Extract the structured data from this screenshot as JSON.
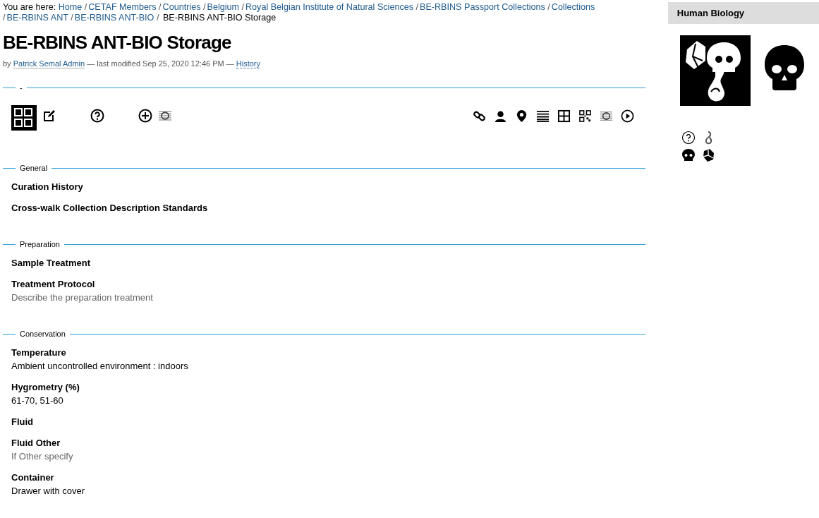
{
  "breadcrumb": {
    "prefix": "You are here:",
    "separator": "/",
    "links": [
      "Home",
      "CETAF Members",
      "Countries",
      "Belgium",
      "Royal Belgian Institute of Natural Sciences",
      "BE-RBINS Passport Collections",
      "Collections",
      "BE-RBINS ANT",
      "BE-RBINS ANT-BIO"
    ],
    "current": "BE-RBINS ANT-BIO Storage"
  },
  "title": "BE-RBINS ANT-BIO Storage",
  "byline": {
    "by": "by",
    "author": "Patrick Semal Admin",
    "modified": "— last modified Sep 25, 2020 12:46 PM —",
    "history": "History"
  },
  "toolbar_legend": "-",
  "sections": [
    {
      "legend": "General",
      "fields": [
        {
          "label": "Curation History"
        },
        {
          "label": "Cross-walk Collection Description Standards"
        }
      ]
    },
    {
      "legend": "Preparation",
      "fields": [
        {
          "label": "Sample Treatment"
        },
        {
          "label": "Treatment Protocol",
          "value": "Describe the preparation treatment",
          "kind": "hint"
        }
      ]
    },
    {
      "legend": "Conservation",
      "fields": [
        {
          "label": "Temperature",
          "value": "Ambient uncontrolled environment : indoors",
          "kind": "value"
        },
        {
          "label": "Hygrometry (%)",
          "value": "61-70, 51-60",
          "kind": "value"
        },
        {
          "label": "Fluid"
        },
        {
          "label": "Fluid Other",
          "value": "If Other specify",
          "kind": "hint"
        },
        {
          "label": "Container",
          "value": "Drawer with cover",
          "kind": "value"
        }
      ]
    }
  ],
  "sidebar": {
    "title": "Human Biology"
  }
}
